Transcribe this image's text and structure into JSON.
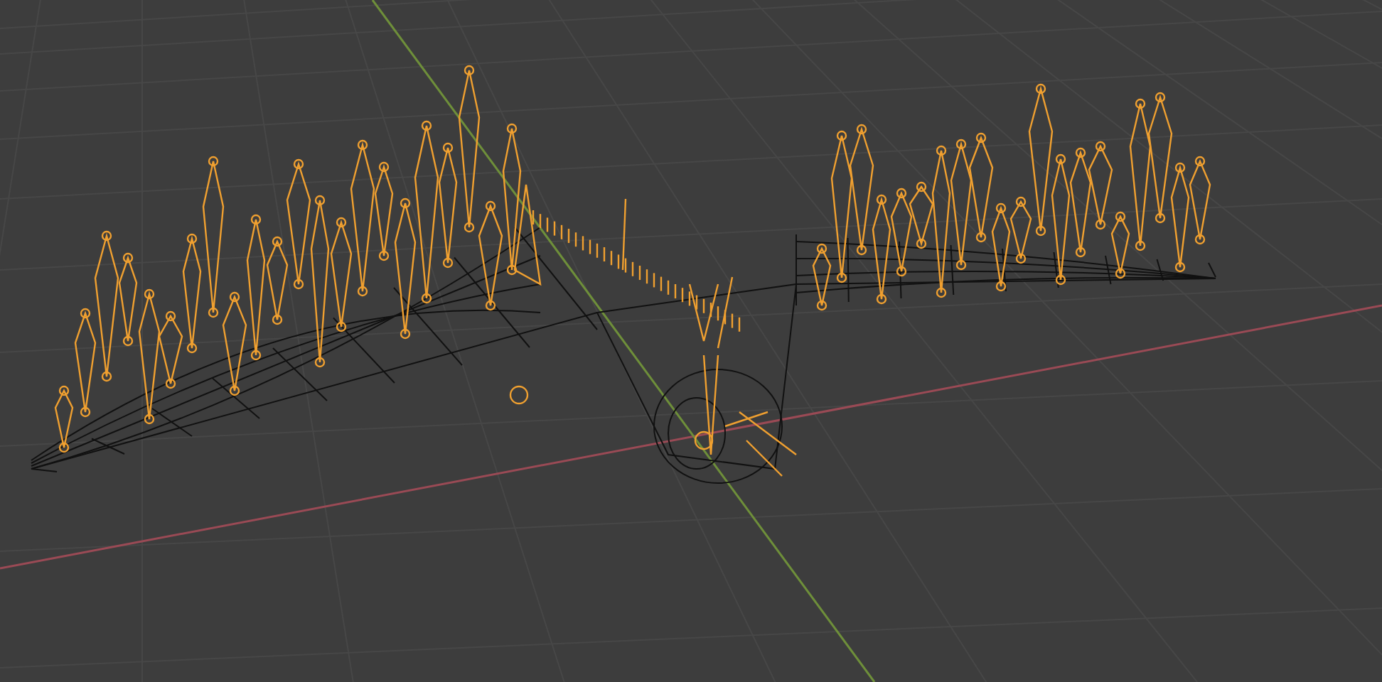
{
  "viewport": {
    "axes": [
      {
        "kind": "x",
        "color": "#9a4a55"
      },
      {
        "kind": "y",
        "color": "#6e8f3a"
      }
    ]
  }
}
